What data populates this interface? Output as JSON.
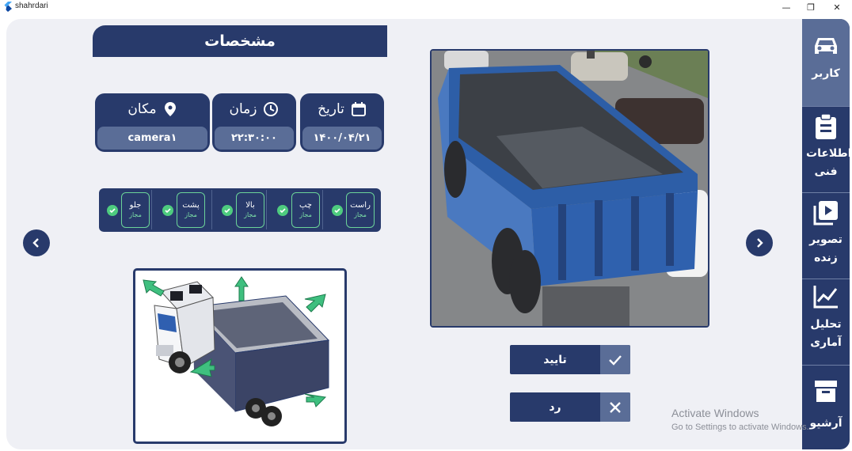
{
  "window": {
    "title": "shahrdari",
    "minimize_glyph": "—",
    "restore_glyph": "❐",
    "close_glyph": "✕"
  },
  "header": {
    "title": "مشخصات"
  },
  "info": {
    "date": {
      "label": "تاریخ",
      "value": "۱۴۰۰/۰۴/۲۱",
      "icon": "calendar-icon"
    },
    "time": {
      "label": "زمان",
      "value": "۲۲:۳۰:۰۰",
      "icon": "clock-icon"
    },
    "location": {
      "label": "مکان",
      "value": "camera۱",
      "icon": "location-pin-icon"
    }
  },
  "sides": [
    {
      "name": "راست",
      "status": "مجاز"
    },
    {
      "name": "چپ",
      "status": "مجاز"
    },
    {
      "name": "بالا",
      "status": "مجاز"
    },
    {
      "name": "پشت",
      "status": "مجاز"
    },
    {
      "name": "جلو",
      "status": "مجاز"
    }
  ],
  "actions": {
    "approve": "تایید",
    "reject": "رد"
  },
  "sidebar": {
    "items": [
      {
        "label": "کاربر",
        "icon": "car-icon",
        "active": true
      },
      {
        "label": "اطلاعات فنی",
        "icon": "clipboard-icon",
        "active": false
      },
      {
        "label": "تصویر زنده",
        "icon": "live-video-icon",
        "active": false
      },
      {
        "label": "تحلیل آماری",
        "icon": "chart-line-icon",
        "active": false
      },
      {
        "label": "آرشیو",
        "icon": "archive-box-icon",
        "active": false
      }
    ]
  },
  "watermark": {
    "line1": "Activate Windows",
    "line2": "Go to Settings to activate Windows."
  },
  "colors": {
    "primary": "#283a6b",
    "secondary": "#5a6d97",
    "panel": "#eff0f5",
    "check": "#4ecb7f",
    "arrow": "#3fbf7f"
  }
}
